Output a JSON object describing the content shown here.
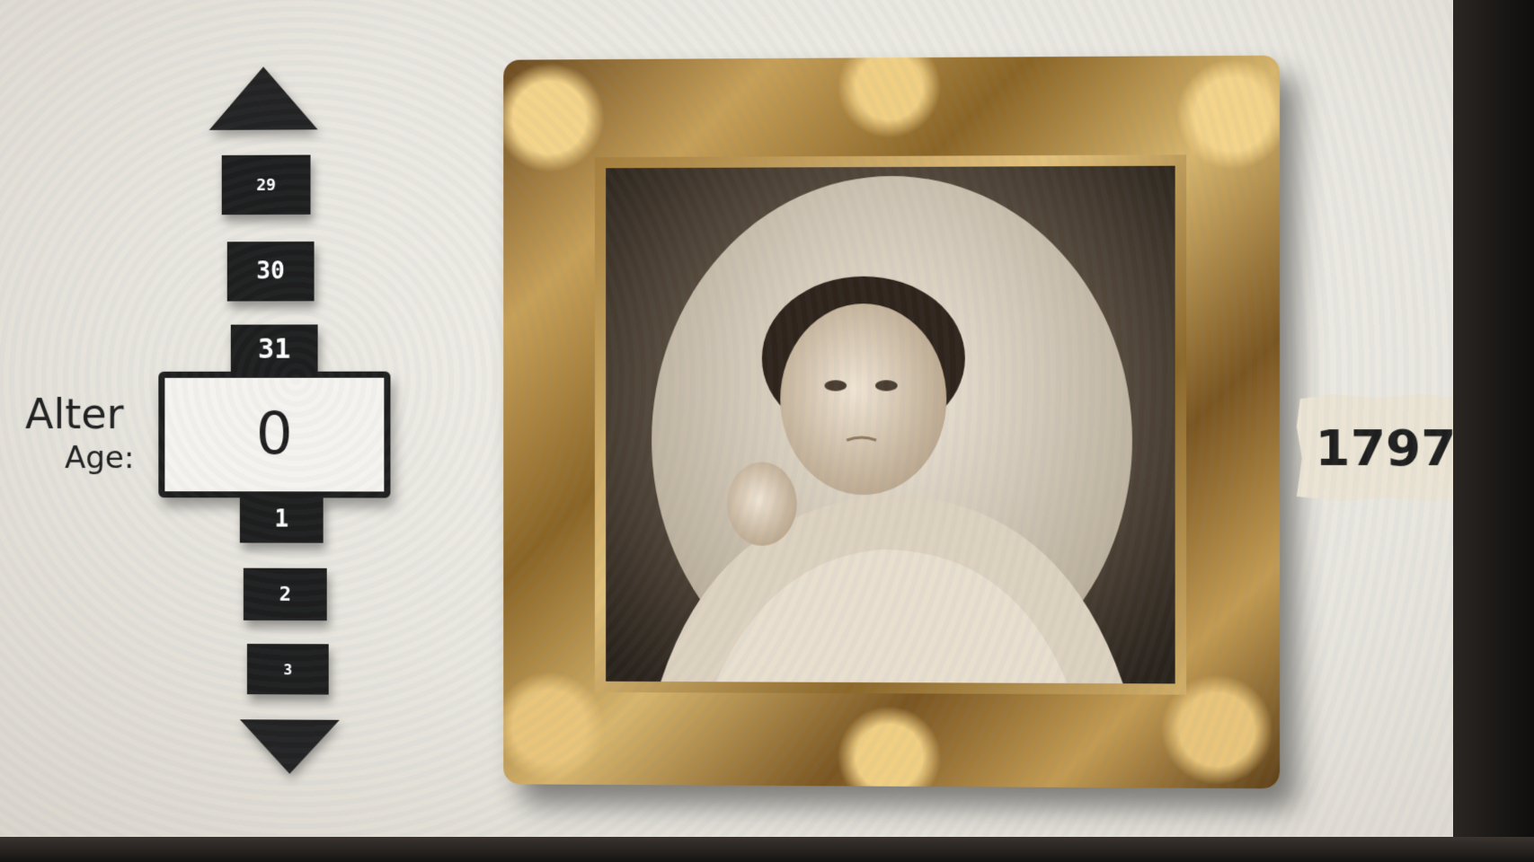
{
  "age_selector": {
    "label_de": "Alter",
    "label_en": "Age:",
    "current_value": "0",
    "above_values": [
      "29",
      "30",
      "31"
    ],
    "below_values": [
      "1",
      "2",
      "3"
    ]
  },
  "year": "1797",
  "icons": {
    "up": "triangle-up-icon",
    "down": "triangle-down-icon"
  },
  "colors": {
    "dark": "#1e1e1e",
    "screen": "#ece9e2",
    "gold": "#c7a058"
  }
}
